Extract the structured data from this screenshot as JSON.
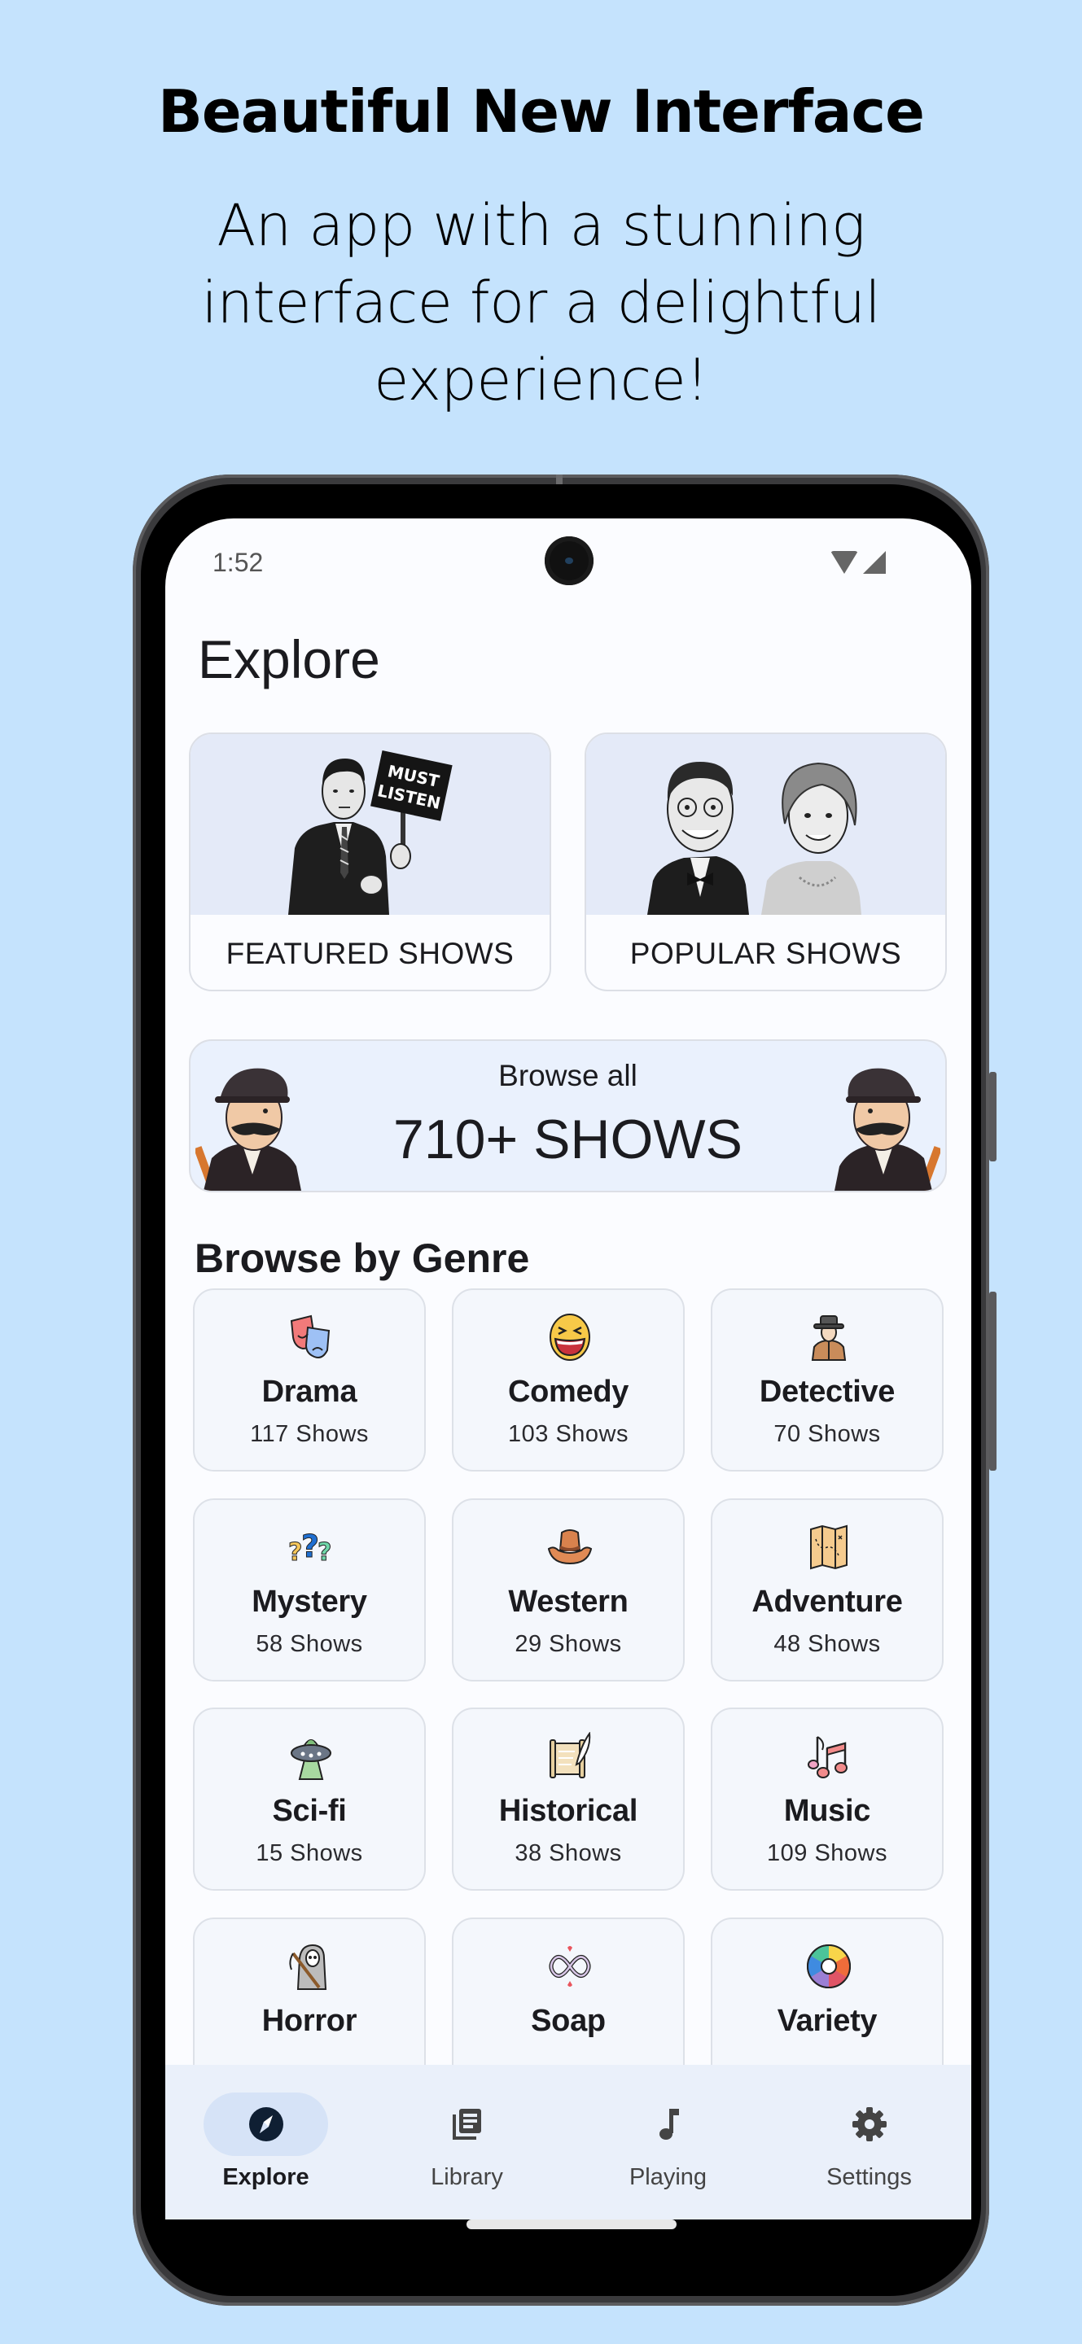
{
  "promo": {
    "title": "Beautiful New Interface",
    "subtitle_lines": [
      "An app with a stunning",
      "interface for a delightful",
      "experience!"
    ]
  },
  "status_bar": {
    "time": "1:52",
    "icons": [
      "wifi-icon",
      "cellular-signal-icon"
    ]
  },
  "page": {
    "title": "Explore"
  },
  "hero_cards": [
    {
      "label": "FEATURED SHOWS",
      "image": "man-holding-must-listen-sign",
      "sign_text": "MUST LISTEN"
    },
    {
      "label": "POPULAR SHOWS",
      "image": "smiling-vintage-couple"
    }
  ],
  "browse_all": {
    "small_label": "Browse all",
    "big_label": "710+ SHOWS",
    "image": "mustached-man-with-bowler-hat"
  },
  "genres": {
    "section_title": "Browse by Genre",
    "items": [
      {
        "name": "Drama",
        "count": "117 Shows",
        "icon": "theater-masks-icon"
      },
      {
        "name": "Comedy",
        "count": "103 Shows",
        "icon": "laughing-face-icon"
      },
      {
        "name": "Detective",
        "count": "70 Shows",
        "icon": "detective-icon"
      },
      {
        "name": "Mystery",
        "count": "58 Shows",
        "icon": "question-marks-icon"
      },
      {
        "name": "Western",
        "count": "29 Shows",
        "icon": "cowboy-hat-icon"
      },
      {
        "name": "Adventure",
        "count": "48 Shows",
        "icon": "treasure-map-icon"
      },
      {
        "name": "Sci-fi",
        "count": "15 Shows",
        "icon": "ufo-icon"
      },
      {
        "name": "Historical",
        "count": "38 Shows",
        "icon": "scroll-quill-icon"
      },
      {
        "name": "Music",
        "count": "109 Shows",
        "icon": "music-notes-icon"
      },
      {
        "name": "Horror",
        "count": "",
        "icon": "grim-reaper-icon"
      },
      {
        "name": "Soap",
        "count": "",
        "icon": "infinity-hearts-icon"
      },
      {
        "name": "Variety",
        "count": "",
        "icon": "color-wheel-icon"
      }
    ]
  },
  "bottom_nav": {
    "items": [
      {
        "label": "Explore",
        "icon": "compass-icon",
        "active": true
      },
      {
        "label": "Library",
        "icon": "library-icon",
        "active": false
      },
      {
        "label": "Playing",
        "icon": "music-note-icon",
        "active": false
      },
      {
        "label": "Settings",
        "icon": "gear-icon",
        "active": false
      }
    ]
  },
  "colors": {
    "background": "#c5e3fd",
    "screen": "#fbfcff",
    "card_tint": "#e4eaf8",
    "genre_card": "#f4f7fc",
    "nav_bg": "#eaf0fa",
    "nav_active_pill": "#d6e3f7",
    "compass": "#0f1f33"
  }
}
